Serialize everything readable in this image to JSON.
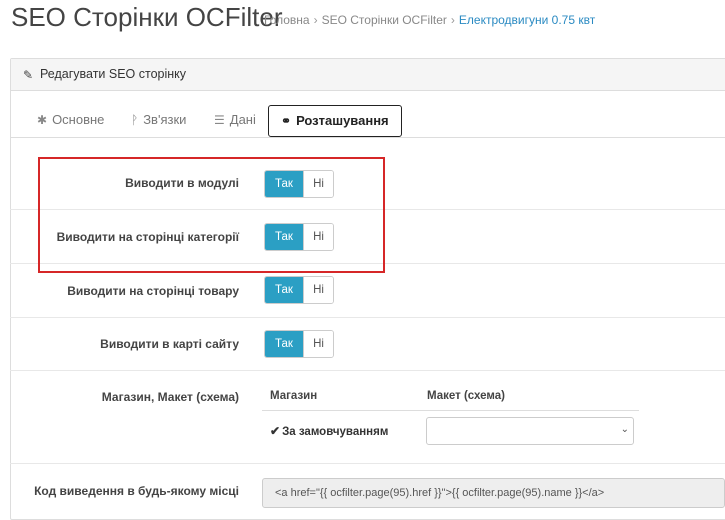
{
  "header": {
    "title": "SEO Сторінки OCFilter",
    "breadcrumb": [
      "Головна",
      "SEO Сторінки OCFilter",
      "Електродвигуни 0.75 квт"
    ],
    "breadcrumb_separator": "›"
  },
  "panel": {
    "heading": "Редагувати SEO сторінку",
    "heading_icon": "pencil-icon"
  },
  "tabs": [
    {
      "label": "Основне",
      "icon": "asterisk-icon",
      "glyph": "✱"
    },
    {
      "label": "Зв'язки",
      "icon": "branch-icon",
      "glyph": "ᚹ"
    },
    {
      "label": "Дані",
      "icon": "list-icon",
      "glyph": "☰"
    },
    {
      "label": "Розташування",
      "icon": "link-icon",
      "glyph": "🔗",
      "active": true
    }
  ],
  "form": {
    "rows": [
      {
        "label": "Виводити в модулі",
        "yes": "Так",
        "no": "Ні",
        "selected": "yes"
      },
      {
        "label": "Виводити на сторінці категорії",
        "yes": "Так",
        "no": "Ні",
        "selected": "yes"
      },
      {
        "label": "Виводити на сторінці товару",
        "yes": "Так",
        "no": "Ні",
        "selected": "yes"
      },
      {
        "label": "Виводити в карті сайту",
        "yes": "Так",
        "no": "Ні",
        "selected": "yes"
      }
    ],
    "store_layout": {
      "label": "Магазин, Макет (схема)",
      "col_store": "Магазин",
      "col_layout": "Макет (схема)",
      "store_value": "За замовчуванням",
      "store_checked": true,
      "layout_value": ""
    },
    "code": {
      "label": "Код виведення в будь-якому місці",
      "value": "<a href=\"{{ ocfilter.page(95).href }}\">{{ ocfilter.page(95).name }}</a>"
    }
  },
  "colors": {
    "accent": "#2b9fc4",
    "highlight_border": "#d62728",
    "breadcrumb_active": "#2a8ac2"
  }
}
